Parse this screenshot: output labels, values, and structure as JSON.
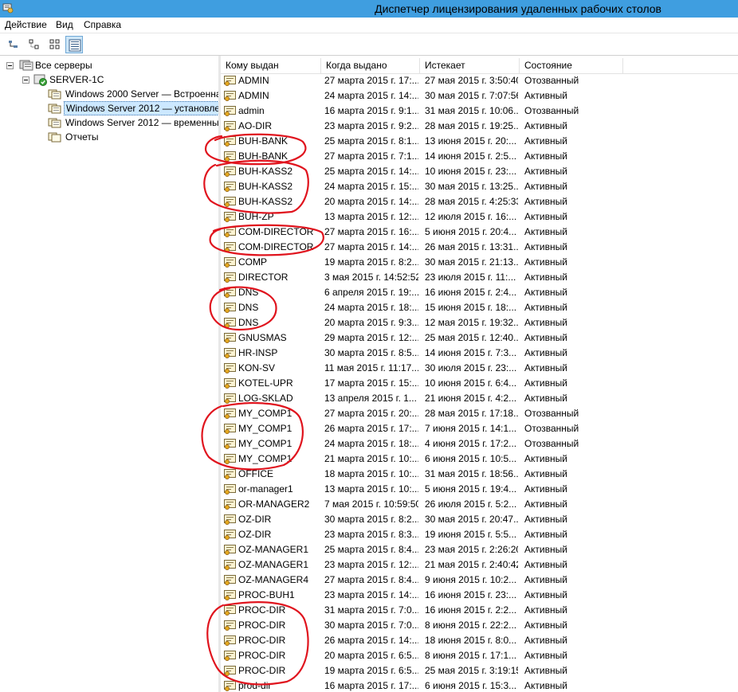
{
  "window": {
    "title": "Диспетчер лицензирования удаленных рабочих столов"
  },
  "menu": [
    {
      "label": "Действие"
    },
    {
      "label": "Вид"
    },
    {
      "label": "Справка"
    }
  ],
  "toolbar": {
    "buttons": [
      "tree-view-icon",
      "expand-icon",
      "group-icon",
      "details-view-icon"
    ],
    "active_button": "details-view-icon"
  },
  "tree": {
    "root": "Все серверы",
    "server": "SERVER-1C",
    "children": [
      {
        "label": "Windows 2000 Server — Встроенна"
      },
      {
        "label": "Windows Server 2012 — установле"
      },
      {
        "label": "Windows Server 2012 — временны"
      },
      {
        "label": "Отчеты"
      }
    ],
    "selected": "Windows Server 2012 — установле"
  },
  "table": {
    "columns": [
      "Кому выдан",
      "Когда выдано",
      "Истекает",
      "Состояние"
    ],
    "rows": [
      {
        "to": "ADMIN",
        "issued": "27 марта 2015 г. 17:...",
        "expires": "27 мая 2015 г. 3:50:40",
        "status": "Отозванный"
      },
      {
        "to": "ADMIN",
        "issued": "24 марта 2015 г. 14:...",
        "expires": "30 мая 2015 г. 7:07:56",
        "status": "Активный"
      },
      {
        "to": "admin",
        "issued": "16 марта 2015 г. 9:1...",
        "expires": "31 мая 2015 г. 10:06...",
        "status": "Отозванный"
      },
      {
        "to": "AO-DIR",
        "issued": "23 марта 2015 г. 9:2...",
        "expires": "28 мая 2015 г. 19:25...",
        "status": "Активный"
      },
      {
        "to": "BUH-BANK",
        "issued": "25 марта 2015 г. 8:1...",
        "expires": "13 июня 2015 г. 20:...",
        "status": "Активный"
      },
      {
        "to": "BUH-BANK",
        "issued": "27 марта 2015 г. 7:1...",
        "expires": "14 июня 2015 г. 2:5...",
        "status": "Активный"
      },
      {
        "to": "BUH-KASS2",
        "issued": "25 марта 2015 г. 14:...",
        "expires": "10 июня 2015 г. 23:...",
        "status": "Активный"
      },
      {
        "to": "BUH-KASS2",
        "issued": "24 марта 2015 г. 15:...",
        "expires": "30 мая 2015 г. 13:25...",
        "status": "Активный"
      },
      {
        "to": "BUH-KASS2",
        "issued": "20 марта 2015 г. 14:...",
        "expires": "28 мая 2015 г. 4:25:33",
        "status": "Активный"
      },
      {
        "to": "BUH-ZP",
        "issued": "13 марта 2015 г. 12:...",
        "expires": "12 июля 2015 г. 16:...",
        "status": "Активный"
      },
      {
        "to": "COM-DIRECTOR",
        "issued": "27 марта 2015 г. 16:...",
        "expires": "5 июня 2015 г. 20:4...",
        "status": "Активный"
      },
      {
        "to": "COM-DIRECTOR",
        "issued": "27 марта 2015 г. 14:...",
        "expires": "26 мая 2015 г. 13:31...",
        "status": "Активный"
      },
      {
        "to": "COMP",
        "issued": "19 марта 2015 г. 8:2...",
        "expires": "30 мая 2015 г. 21:13...",
        "status": "Активный"
      },
      {
        "to": "DIRECTOR",
        "issued": "3 мая 2015 г. 14:52:52",
        "expires": "23 июля 2015 г. 11:...",
        "status": "Активный"
      },
      {
        "to": "DNS",
        "issued": "6 апреля 2015 г. 19:...",
        "expires": "16 июня 2015 г. 2:4...",
        "status": "Активный"
      },
      {
        "to": "DNS",
        "issued": "24 марта 2015 г. 18:...",
        "expires": "15 июня 2015 г. 18:...",
        "status": "Активный"
      },
      {
        "to": "DNS",
        "issued": "20 марта 2015 г. 9:3...",
        "expires": "12 мая 2015 г. 19:32...",
        "status": "Активный"
      },
      {
        "to": "GNUSMAS",
        "issued": "29 марта 2015 г. 12:...",
        "expires": "25 мая 2015 г. 12:40...",
        "status": "Активный"
      },
      {
        "to": "HR-INSP",
        "issued": "30 марта 2015 г. 8:5...",
        "expires": "14 июня 2015 г. 7:3...",
        "status": "Активный"
      },
      {
        "to": "KON-SV",
        "issued": "11 мая 2015 г. 11:17...",
        "expires": "30 июля 2015 г. 23:...",
        "status": "Активный"
      },
      {
        "to": "KOTEL-UPR",
        "issued": "17 марта 2015 г. 15:...",
        "expires": "10 июня 2015 г. 6:4...",
        "status": "Активный"
      },
      {
        "to": "LOG-SKLAD",
        "issued": "13 апреля 2015 г. 1...",
        "expires": "21 июня 2015 г. 4:2...",
        "status": "Активный"
      },
      {
        "to": "MY_COMP1",
        "issued": "27 марта 2015 г. 20:...",
        "expires": "28 мая 2015 г. 17:18...",
        "status": "Отозванный"
      },
      {
        "to": "MY_COMP1",
        "issued": "26 марта 2015 г. 17:...",
        "expires": "7 июня 2015 г. 14:1...",
        "status": "Отозванный"
      },
      {
        "to": "MY_COMP1",
        "issued": "24 марта 2015 г. 18:...",
        "expires": "4 июня 2015 г. 17:2...",
        "status": "Отозванный"
      },
      {
        "to": "MY_COMP1",
        "issued": "21 марта 2015 г. 10:...",
        "expires": "6 июня 2015 г. 10:5...",
        "status": "Активный"
      },
      {
        "to": "OFFICE",
        "issued": "18 марта 2015 г. 10:...",
        "expires": "31 мая 2015 г. 18:56...",
        "status": "Активный"
      },
      {
        "to": "or-manager1",
        "issued": "13 марта 2015 г. 10:...",
        "expires": "5 июня 2015 г. 19:4...",
        "status": "Активный"
      },
      {
        "to": "OR-MANAGER2",
        "issued": "7 мая 2015 г. 10:59:50",
        "expires": "26 июля 2015 г. 5:2...",
        "status": "Активный"
      },
      {
        "to": "OZ-DIR",
        "issued": "30 марта 2015 г. 8:2...",
        "expires": "30 мая 2015 г. 20:47...",
        "status": "Активный"
      },
      {
        "to": "OZ-DIR",
        "issued": "23 марта 2015 г. 8:3...",
        "expires": "19 июня 2015 г. 5:5...",
        "status": "Активный"
      },
      {
        "to": "OZ-MANAGER1",
        "issued": "25 марта 2015 г. 8:4...",
        "expires": "23 мая 2015 г. 2:26:20",
        "status": "Активный"
      },
      {
        "to": "OZ-MANAGER1",
        "issued": "23 марта 2015 г. 12:...",
        "expires": "21 мая 2015 г. 2:40:42",
        "status": "Активный"
      },
      {
        "to": "OZ-MANAGER4",
        "issued": "27 марта 2015 г. 8:4...",
        "expires": "9 июня 2015 г. 10:2...",
        "status": "Активный"
      },
      {
        "to": "PROC-BUH1",
        "issued": "23 марта 2015 г. 14:...",
        "expires": "16 июня 2015 г. 23:...",
        "status": "Активный"
      },
      {
        "to": "PROC-DIR",
        "issued": "31 марта 2015 г. 7:0...",
        "expires": "16 июня 2015 г. 2:2...",
        "status": "Активный"
      },
      {
        "to": "PROC-DIR",
        "issued": "30 марта 2015 г. 7:0...",
        "expires": "8 июня 2015 г. 22:2...",
        "status": "Активный"
      },
      {
        "to": "PROC-DIR",
        "issued": "26 марта 2015 г. 14:...",
        "expires": "18 июня 2015 г. 8:0...",
        "status": "Активный"
      },
      {
        "to": "PROC-DIR",
        "issued": "20 марта 2015 г. 6:5...",
        "expires": "8 июня 2015 г. 17:1...",
        "status": "Активный"
      },
      {
        "to": "PROC-DIR",
        "issued": "19 марта 2015 г. 6:5...",
        "expires": "25 мая 2015 г. 3:19:15",
        "status": "Активный"
      },
      {
        "to": "prod-dir",
        "issued": "16 марта 2015 г. 17:...",
        "expires": "6 июня 2015 г. 15:3...",
        "status": "Активный"
      }
    ]
  },
  "annotation_color": "#e0141e"
}
